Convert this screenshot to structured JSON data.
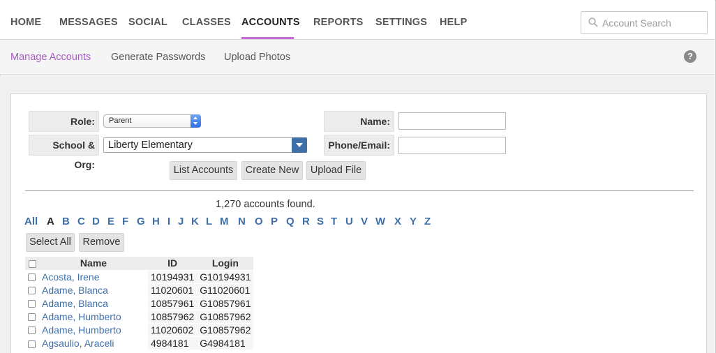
{
  "nav": {
    "items": [
      "HOME",
      "MESSAGES",
      "SOCIAL",
      "CLASSES",
      "ACCOUNTS",
      "REPORTS",
      "SETTINGS",
      "HELP"
    ],
    "active": "ACCOUNTS",
    "search_placeholder": "Account Search"
  },
  "subnav": {
    "items": [
      "Manage Accounts",
      "Generate Passwords",
      "Upload Photos"
    ],
    "active": "Manage Accounts",
    "help_icon": "?"
  },
  "form": {
    "role_label": "Role:",
    "role_value": "Parent",
    "school_label": "School & Org:",
    "school_value": "Liberty Elementary",
    "name_label": "Name:",
    "name_value": "",
    "phone_label": "Phone/Email:",
    "phone_value": "",
    "list_button": "List Accounts",
    "create_button": "Create New",
    "upload_button": "Upload File"
  },
  "results": {
    "count_text": "1,270 accounts found.",
    "letters": [
      "All",
      "A",
      "B",
      "C",
      "D",
      "E",
      "F",
      "G",
      "H",
      "I",
      "J",
      "K",
      "L",
      "M",
      "N",
      "O",
      "P",
      "Q",
      "R",
      "S",
      "T",
      "U",
      "V",
      "W",
      "X",
      "Y",
      "Z"
    ],
    "current_letter": "A",
    "select_all": "Select All",
    "remove": "Remove",
    "columns": [
      "Name",
      "ID",
      "Login"
    ],
    "rows": [
      {
        "name": "Acosta, Irene",
        "id": "10194931",
        "login": "G10194931"
      },
      {
        "name": "Adame, Blanca",
        "id": "11020601",
        "login": "G11020601"
      },
      {
        "name": "Adame, Blanca",
        "id": "10857961",
        "login": "G10857961"
      },
      {
        "name": "Adame, Humberto",
        "id": "10857962",
        "login": "G10857962"
      },
      {
        "name": "Adame, Humberto",
        "id": "11020602",
        "login": "G10857962"
      },
      {
        "name": "Agsaulio, Araceli",
        "id": "4984181",
        "login": "G4984181"
      }
    ]
  },
  "colors": {
    "accent": "#c56ad6",
    "link": "#3f6fa8"
  }
}
